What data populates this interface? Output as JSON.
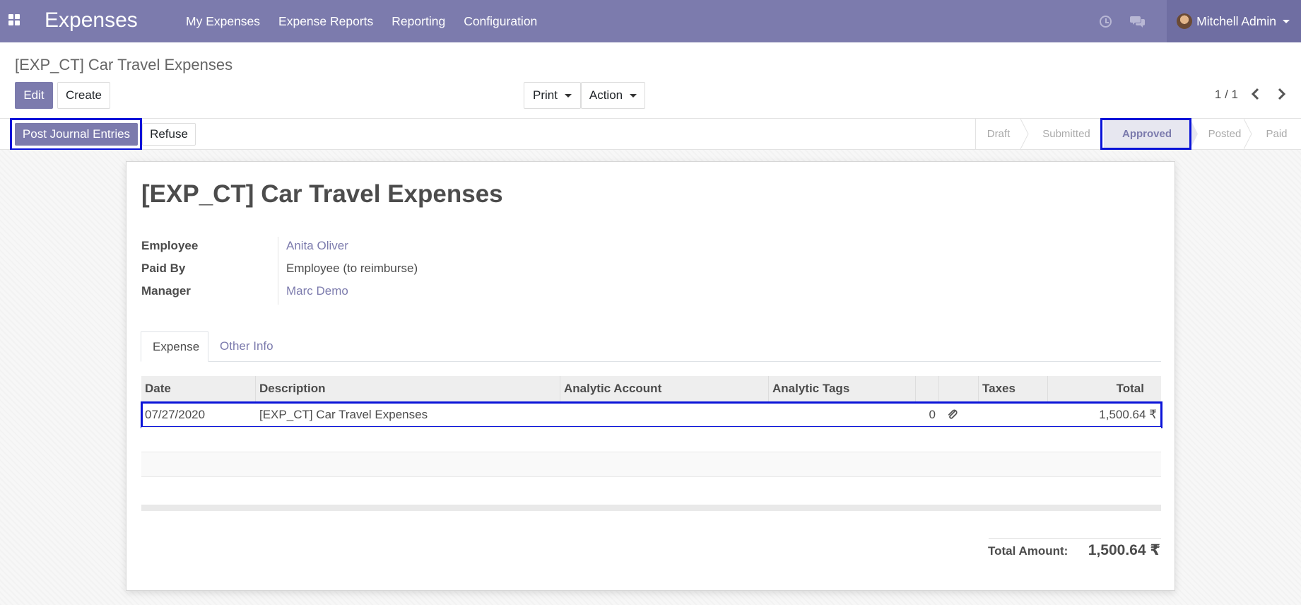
{
  "app": {
    "name": "Expenses",
    "menu": [
      "My Expenses",
      "Expense Reports",
      "Reporting",
      "Configuration"
    ],
    "user": "Mitchell Admin",
    "accent_color": "#7c7bad",
    "icons": [
      "apps-icon",
      "clock-icon",
      "chat-icon",
      "avatar"
    ]
  },
  "control_panel": {
    "breadcrumb": "[EXP_CT] Car Travel Expenses",
    "edit_label": "Edit",
    "create_label": "Create",
    "print_label": "Print",
    "action_label": "Action",
    "pager": "1 / 1"
  },
  "statusbar": {
    "buttons": {
      "post": "Post Journal Entries",
      "refuse": "Refuse"
    },
    "stages": [
      "Draft",
      "Submitted",
      "Approved",
      "Posted",
      "Paid"
    ],
    "active_stage": "Approved"
  },
  "form": {
    "title": "[EXP_CT] Car Travel Expenses",
    "fields": {
      "employee": {
        "label": "Employee",
        "value": "Anita Oliver"
      },
      "paid_by": {
        "label": "Paid By",
        "value": "Employee (to reimburse)"
      },
      "manager": {
        "label": "Manager",
        "value": "Marc Demo"
      }
    },
    "tabs": [
      "Expense",
      "Other Info"
    ],
    "active_tab": "Expense",
    "table": {
      "columns": [
        "Date",
        "Description",
        "Analytic Account",
        "Analytic Tags",
        "",
        "",
        "Taxes",
        "Total"
      ],
      "rows": [
        {
          "date": "07/27/2020",
          "description": "[EXP_CT] Car Travel Expenses",
          "analytic_account": "",
          "analytic_tags": "",
          "attachments": "0",
          "taxes": "",
          "total": "1,500.64 ₹"
        }
      ]
    },
    "total_label": "Total Amount:",
    "total_value": "1,500.64 ₹"
  }
}
